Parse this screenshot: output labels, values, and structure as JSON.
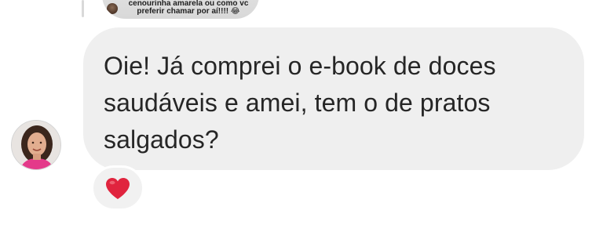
{
  "reply_preview": {
    "text": "cenourinha amarela ou como vc\npreferir chamar por aí!!!! 😂"
  },
  "message": {
    "text": "Oie! Já comprei o e-book de doces saudáveis e amei, tem o de pratos salgados?"
  },
  "sender": {
    "avatar": "profile-photo"
  },
  "reaction": {
    "emoji": "red-heart-icon",
    "color": "#e0245e"
  },
  "colors": {
    "bubble": "#efefef",
    "text": "#262626",
    "background": "#ffffff"
  }
}
